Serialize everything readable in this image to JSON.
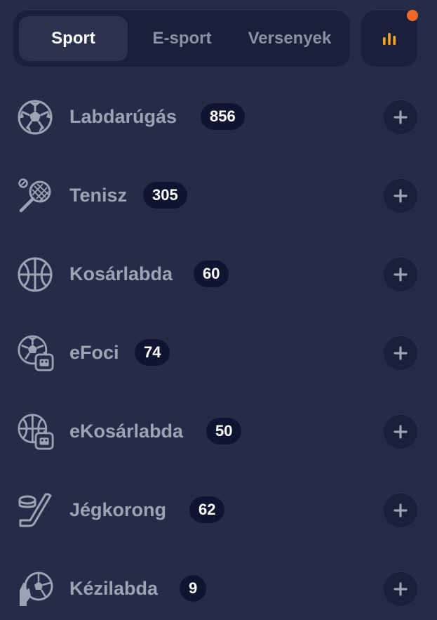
{
  "tabs": [
    {
      "label": "Sport",
      "active": true
    },
    {
      "label": "E-sport",
      "active": false
    },
    {
      "label": "Versenyek",
      "active": false
    }
  ],
  "stats_button": {
    "icon": "bar-chart-icon",
    "notification": true,
    "dot_color": "#f2682a",
    "accent": "#f5a623"
  },
  "sports": [
    {
      "name": "Labdarúgás",
      "count": "856",
      "icon": "soccer-ball-icon"
    },
    {
      "name": "Tenisz",
      "count": "305",
      "icon": "tennis-racket-icon"
    },
    {
      "name": "Kosárlabda",
      "count": "60",
      "icon": "basketball-icon"
    },
    {
      "name": "eFoci",
      "count": "74",
      "icon": "esoccer-icon"
    },
    {
      "name": "eKosárlabda",
      "count": "50",
      "icon": "ebasketball-icon"
    },
    {
      "name": "Jégkorong",
      "count": "62",
      "icon": "ice-hockey-icon"
    },
    {
      "name": "Kézilabda",
      "count": "9",
      "icon": "handball-icon"
    }
  ],
  "colors": {
    "background": "#252c47",
    "panel": "#1a203a",
    "badge": "#0f1530",
    "text_muted": "#9ea3b4"
  }
}
